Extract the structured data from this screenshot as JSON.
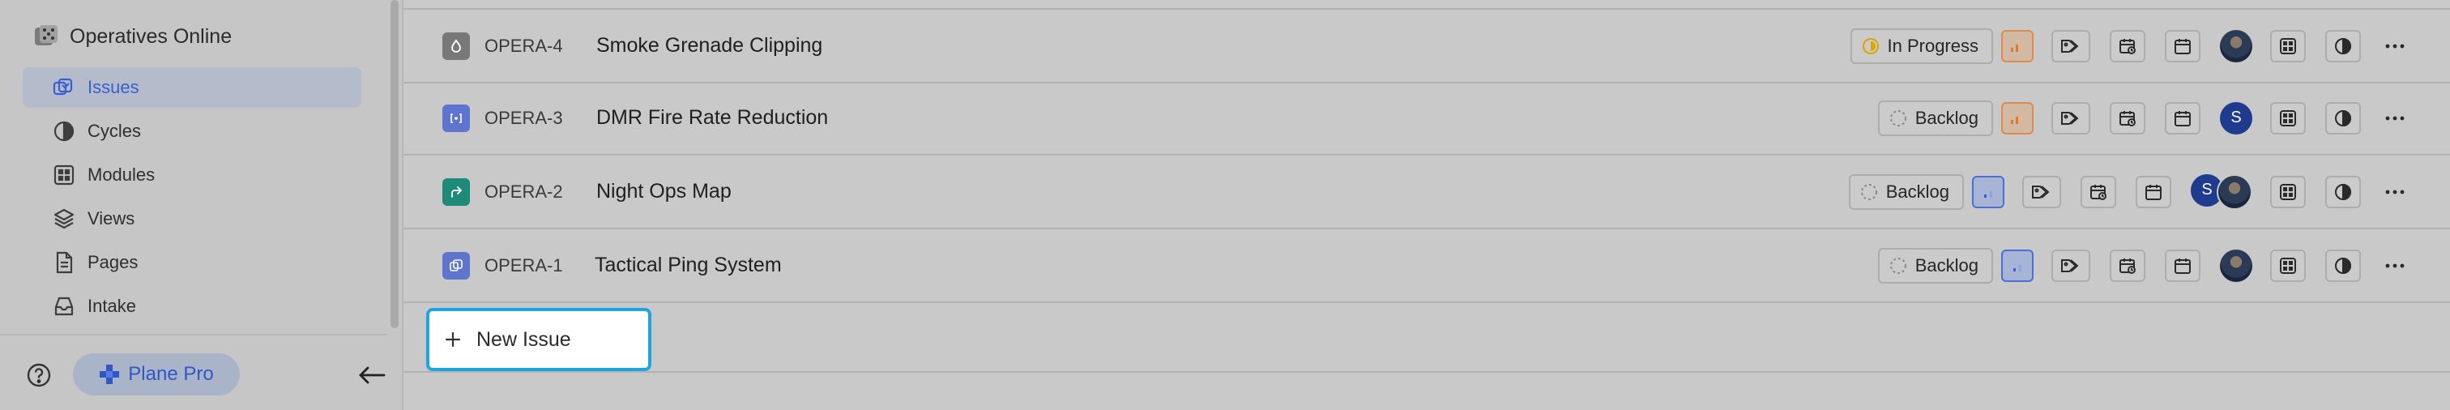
{
  "sidebar": {
    "workspace_name": "Operatives Online",
    "items": [
      {
        "label": "Issues",
        "icon": "issues-icon",
        "active": true
      },
      {
        "label": "Cycles",
        "icon": "cycles-icon",
        "active": false
      },
      {
        "label": "Modules",
        "icon": "modules-icon",
        "active": false
      },
      {
        "label": "Views",
        "icon": "views-icon",
        "active": false
      },
      {
        "label": "Pages",
        "icon": "pages-icon",
        "active": false
      },
      {
        "label": "Intake",
        "icon": "intake-icon",
        "active": false
      }
    ],
    "footer": {
      "help_icon": "help-icon",
      "plan_label": "Plane Pro",
      "collapse_icon": "arrow-left-icon"
    }
  },
  "issues": [
    {
      "id": "OPERA-4",
      "title": "Smoke Grenade Clipping",
      "state": "In Progress",
      "priority": "medium",
      "assignees": [
        "photo"
      ]
    },
    {
      "id": "OPERA-3",
      "title": "DMR Fire Rate Reduction",
      "state": "Backlog",
      "priority": "medium",
      "assignees": [
        "S"
      ]
    },
    {
      "id": "OPERA-2",
      "title": "Night Ops Map",
      "state": "Backlog",
      "priority": "low",
      "assignees": [
        "S",
        "photo"
      ]
    },
    {
      "id": "OPERA-1",
      "title": "Tactical Ping System",
      "state": "Backlog",
      "priority": "low",
      "assignees": [
        "photo"
      ]
    }
  ],
  "new_issue_label": "New Issue",
  "colors": {
    "accent": "#3a5fcf",
    "focus_ring": "#1ea5e0",
    "priority_medium": "#e08a4d",
    "priority_low": "#4a6fd6",
    "state_in_progress": "#e0a400"
  }
}
